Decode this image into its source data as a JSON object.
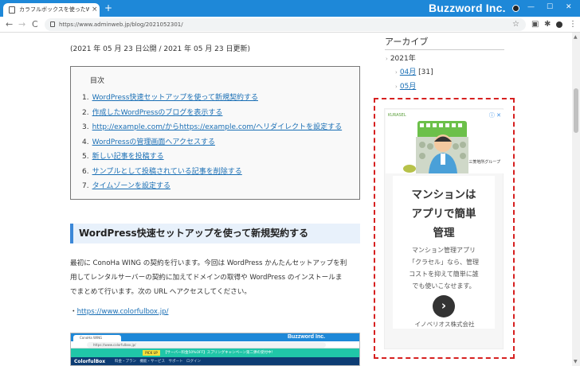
{
  "browser": {
    "tab_title": "カラフルボックスを使ったWordPress",
    "tab_close": "×",
    "new_tab": "+",
    "brand": "Buzzword Inc.",
    "window_buttons": [
      "—",
      "☐",
      "✕"
    ],
    "url": "https://www.adminweb.jp/blog/2021052301/",
    "nav": {
      "back": "←",
      "forward": "→",
      "reload": "C"
    },
    "star": "☆",
    "menu": "⋮"
  },
  "article": {
    "dates": "(2021 年 05 月 23 日公開 / 2021 年 05 月 23 日更新)",
    "toc": {
      "title": "目次",
      "items": [
        {
          "num": "1.",
          "label": "WordPress快速セットアップを使って新規契約する"
        },
        {
          "num": "2.",
          "label": "作成したWordPressのブログを表示する"
        },
        {
          "num": "3.",
          "label": "http://example.com/からhttps://example.com/へリダイレクトを設定する"
        },
        {
          "num": "4.",
          "label": "WordPressの管理画面へアクセスする"
        },
        {
          "num": "5.",
          "label": "新しい記事を投稿する"
        },
        {
          "num": "6.",
          "label": "サンプルとして投稿されている記事を削除する"
        },
        {
          "num": "7.",
          "label": "タイムゾーンを設定する"
        }
      ]
    },
    "heading": "WordPress快速セットアップを使って新規契約する",
    "paragraph_lines": [
      "最初に ConoHa WING の契約を行います。今回は WordPress かんたんセットアップを利",
      "用してレンタルサーバーの契約に加えてドメインの取得や WordPress のインストールま",
      "でまとめて行います。次の URL へアクセスしてください。"
    ],
    "link_prefix": "・",
    "link": "https://www.colorfulbox.jp/",
    "screenshot": {
      "tab": "ConoHa WING",
      "brand": "Buzzword Inc.",
      "url": "https://www.colorfulbox.jp/",
      "promo_tag": "PICK UP",
      "promo_text": "【サーバー料金50%OFF】スプリングキャンペーン第二弾の受付中！",
      "logo": "ColorfulBox",
      "menu": "料金・プラン　機能・サービス　サポート　ログイン"
    }
  },
  "sidebar": {
    "title": "アーカイブ",
    "year": "2021年",
    "months": [
      {
        "label": "04月",
        "count": "[31]"
      },
      {
        "label": "05月",
        "count": ""
      }
    ]
  },
  "ad": {
    "logo": "KURASEL",
    "info": "ⓘ ✕",
    "company_small": "三菱地所グループ",
    "headline_lines": [
      "マンションは",
      "アプリで簡単",
      "管理"
    ],
    "body_lines": [
      "マンション管理アプリ",
      "「クラセル」なら、管理",
      "コストを抑えて簡単に誰",
      "でも使いこなせます。"
    ],
    "cta": "›",
    "company": "イノベリオス株式会社"
  },
  "scrollbar": {
    "up": "▲",
    "down": "▼"
  },
  "colors": {
    "titlebar": "#1e88d8",
    "link": "#1a6fb5",
    "heading_bg": "#e8f1fb",
    "heading_accent": "#3c88d8",
    "ad_frame": "#d62020"
  }
}
